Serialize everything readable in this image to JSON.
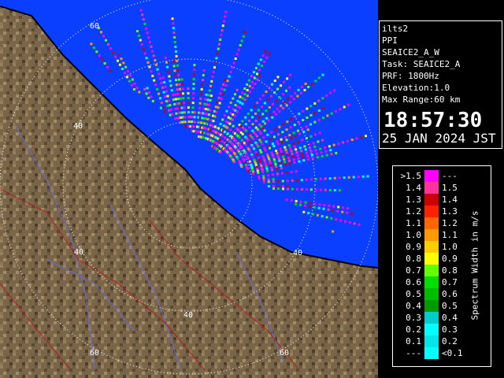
{
  "info_panel": {
    "station": "ilts2",
    "scan_type": "PPI",
    "scan_name": "SEAICE2_A_W",
    "task": "Task: SEAICE2_A",
    "prf": "PRF: 1800Hz",
    "elevation": "Elevation:1.0",
    "max_range": "Max Range:60 km",
    "time": "18:57:30",
    "date": "25 JAN 2024 JST"
  },
  "legend": {
    "unit_label": "Spectrum Width in m/s",
    "left_labels": [
      ">1.5",
      "1.4",
      "1.3",
      "1.2",
      "1.1",
      "1.0",
      "0.9",
      "0.8",
      "0.7",
      "0.6",
      "0.5",
      "0.4",
      "0.3",
      "0.2",
      "0.1",
      "---"
    ],
    "right_labels": [
      "---",
      "1.5",
      "1.4",
      "1.3",
      "1.2",
      "1.1",
      "1.0",
      "0.9",
      "0.8",
      "0.7",
      "0.6",
      "0.5",
      "0.4",
      "0.3",
      "0.2",
      "<0.1"
    ],
    "colors": [
      "#ff00ff",
      "#ff3399",
      "#cc0000",
      "#ff2200",
      "#ff6600",
      "#ff9900",
      "#ffcc00",
      "#ffff00",
      "#66ff00",
      "#00dd00",
      "#00bb00",
      "#009900",
      "#00cccc",
      "#00ffff",
      "#00e5e5",
      "#00ffff"
    ]
  },
  "map": {
    "range_ring_labels": [
      "60",
      "40",
      "40",
      "40",
      "40",
      "60",
      "60"
    ],
    "sea_color": "#0a3fff",
    "land_color": "#7a6548",
    "coast_color": "#000000"
  }
}
